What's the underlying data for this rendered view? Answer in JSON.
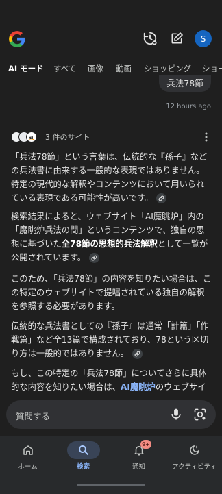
{
  "header": {
    "avatar_letter": "S"
  },
  "tabs": [
    {
      "label": "AI モード",
      "active": true
    },
    {
      "label": "すべて"
    },
    {
      "label": "画像"
    },
    {
      "label": "動画"
    },
    {
      "label": "ショッピング"
    },
    {
      "label": "ショー"
    }
  ],
  "query": {
    "text": "兵法78節",
    "time": "12 hours ago"
  },
  "sources": {
    "label": "3 件のサイト"
  },
  "answer": {
    "p1": "「兵法78節」という言葉は、伝統的な『孫子』などの兵法書に由来する一般的な表現ではありません。特定の現代的な解釈やコンテンツにおいて用いられている表現である可能性が高いです。",
    "p2_a": "検索結果によると、ウェブサイト「AI魔眺炉」内の「魔眺炉兵法の間」というコンテンツで、独自の思想に基づいた",
    "p2_bold": "全78節の思想的兵法解釈",
    "p2_b": "として一覧が公開されています。",
    "p3": "このため、「兵法78節」の内容を知りたい場合は、この特定のウェブサイトで提唱されている独自の解釈を参照する必要があります。",
    "p4": "伝統的な兵法書としての『孫子』は通常「計篇」「作戦篇」など全13篇で構成されており、78という区切り方は一般的ではありません。",
    "p5_a": "もし、この特定の「兵法78節」についてさらに具体的な内容を知りたい場合は、",
    "p5_link": "AI魔眺炉",
    "p5_b": "のウェブサイ"
  },
  "ask": {
    "placeholder": "質問する"
  },
  "nav": {
    "home": "ホーム",
    "search": "検索",
    "notifications": "通知",
    "notifications_badge": "9+",
    "activity": "アクティビティ"
  },
  "colors": {
    "background": "#1f1f1f",
    "accent": "#8ab4f8",
    "avatar": "#1565c0",
    "badge": "#f28b82"
  }
}
